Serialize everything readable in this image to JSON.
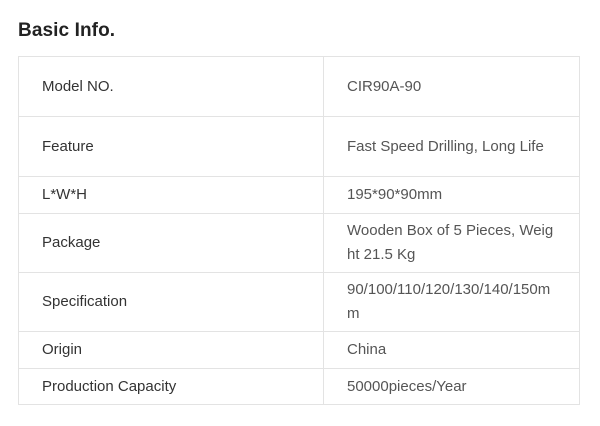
{
  "section": {
    "title": "Basic Info."
  },
  "rows": [
    {
      "label": "Model NO.",
      "value": "CIR90A-90"
    },
    {
      "label": "Feature",
      "value": "Fast Speed Drilling, Long Life"
    },
    {
      "label": "L*W*H",
      "value": "195*90*90mm"
    },
    {
      "label": "Package",
      "value": "Wooden Box of 5 Pieces, Weight 21.5 Kg"
    },
    {
      "label": "Specification",
      "value": "90/100/110/120/130/140/150mm"
    },
    {
      "label": "Origin",
      "value": "China"
    },
    {
      "label": "Production Capacity",
      "value": "50000pieces/Year"
    }
  ]
}
